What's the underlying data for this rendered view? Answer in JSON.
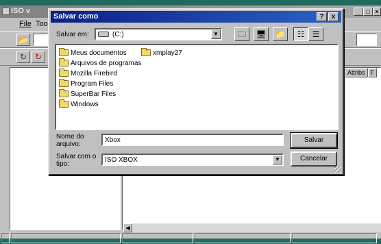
{
  "background_app": {
    "title": "ISO v",
    "menu": [
      "File",
      "Too"
    ],
    "column_headers": [
      "Attribs",
      "F"
    ]
  },
  "dialog": {
    "title": "Salvar como",
    "help_label": "?",
    "close_label": "x",
    "save_in_label": "Salvar em:",
    "save_in_value": "(C:)",
    "folders": [
      "Meus documentos",
      "xmplay27",
      "Arquivos de programas",
      "Mozilla Firebird",
      "Program Files",
      "SuperBar Files",
      "Windows"
    ],
    "file_name_label_1": "Nome do",
    "file_name_label_2": "arquivo:",
    "file_name_value": "Xbox",
    "save_as_type_label_1": "Salvar com o",
    "save_as_type_label_2": "tipo:",
    "save_as_type_value": "ISO XBOX",
    "save_button": "Salvar",
    "cancel_button": "Cancelar"
  },
  "icons": {
    "toolbar": [
      "up-folder-icon",
      "desktop-icon",
      "new-folder-icon",
      "list-view-icon",
      "details-view-icon"
    ],
    "drive": "hard-drive-icon",
    "folder": "folder-icon"
  },
  "colors": {
    "title_bar_active": "#0a1f86",
    "title_bar_inactive": "#808080",
    "desktop": "#1f6b5e"
  }
}
